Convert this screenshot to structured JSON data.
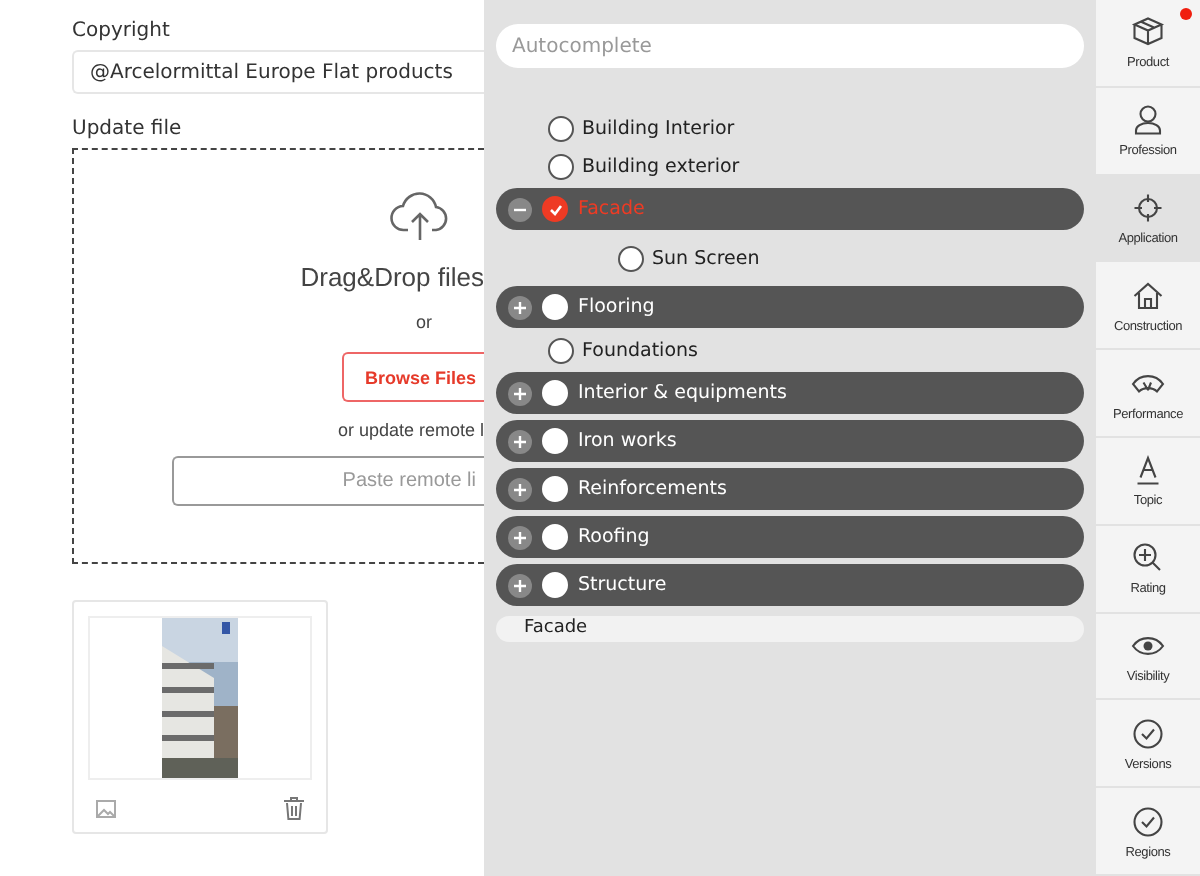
{
  "form": {
    "copyright_label": "Copyright",
    "copyright_value": "@Arcelormittal Europe Flat products",
    "update_label": "Update file",
    "dropzone": {
      "title": "Drag&Drop files",
      "or": "or",
      "browse_button": "Browse Files",
      "remote_hint": "or update remote l",
      "remote_placeholder": "Paste remote li"
    }
  },
  "panel": {
    "search": {
      "placeholder": "Autocomplete"
    },
    "tree": [
      {
        "kind": "leaf",
        "label": "Building Interior",
        "checked": false
      },
      {
        "kind": "leaf",
        "label": "Building exterior",
        "checked": false
      },
      {
        "kind": "group",
        "label": "Facade",
        "checked": true,
        "expanded": true,
        "children": [
          {
            "kind": "leaf",
            "label": "Sun Screen",
            "checked": false
          }
        ]
      },
      {
        "kind": "group",
        "label": "Flooring",
        "checked": false,
        "expanded": false
      },
      {
        "kind": "leaf",
        "label": "Foundations",
        "checked": false
      },
      {
        "kind": "group",
        "label": "Interior & equipments",
        "checked": false,
        "expanded": false
      },
      {
        "kind": "group",
        "label": "Iron works",
        "checked": false,
        "expanded": false
      },
      {
        "kind": "group",
        "label": "Reinforcements",
        "checked": false,
        "expanded": false
      },
      {
        "kind": "group",
        "label": "Roofing",
        "checked": false,
        "expanded": false
      },
      {
        "kind": "group",
        "label": "Structure",
        "checked": false,
        "expanded": false
      }
    ],
    "selection": [
      "Facade"
    ]
  },
  "sidebar": {
    "items": [
      {
        "kind": "box",
        "label": "Product",
        "selected": false,
        "badge": true
      },
      {
        "kind": "person",
        "label": "Profession",
        "selected": false,
        "badge": false
      },
      {
        "kind": "target",
        "label": "Application",
        "selected": true,
        "badge": false
      },
      {
        "kind": "house",
        "label": "Construction",
        "selected": false,
        "badge": false
      },
      {
        "kind": "gauge",
        "label": "Performance",
        "selected": false,
        "badge": false
      },
      {
        "kind": "letter",
        "label": "Topic",
        "selected": false,
        "badge": false
      },
      {
        "kind": "zoom",
        "label": "Rating",
        "selected": false,
        "badge": false
      },
      {
        "kind": "eye",
        "label": "Visibility",
        "selected": false,
        "badge": false
      },
      {
        "kind": "check",
        "label": "Versions",
        "selected": false,
        "badge": false
      },
      {
        "kind": "check",
        "label": "Regions",
        "selected": false,
        "badge": false
      }
    ]
  }
}
